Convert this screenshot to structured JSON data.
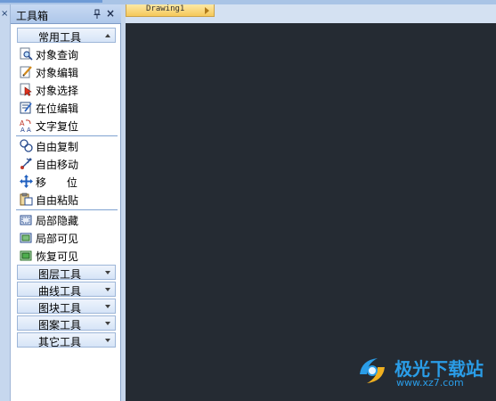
{
  "left_strip": {
    "close_glyph": "×"
  },
  "toolbox": {
    "title": "工具箱",
    "pin_icon": "pin-icon",
    "close_glyph": "×",
    "groups": [
      {
        "label": "常用工具",
        "expanded": true
      },
      {
        "label": "图层工具",
        "expanded": false
      },
      {
        "label": "曲线工具",
        "expanded": false
      },
      {
        "label": "图块工具",
        "expanded": false
      },
      {
        "label": "图案工具",
        "expanded": false
      },
      {
        "label": "其它工具",
        "expanded": false
      }
    ],
    "items": [
      {
        "label": "对象查询",
        "icon": "magnifier-doc-icon"
      },
      {
        "label": "对象编辑",
        "icon": "pencil-doc-icon"
      },
      {
        "label": "对象选择",
        "icon": "select-arrow-icon"
      },
      {
        "label": "在位编辑",
        "icon": "inplace-edit-icon"
      },
      {
        "label": "文字复位",
        "icon": "text-reset-icon"
      },
      {
        "label": "自由复制",
        "icon": "copy-circles-icon"
      },
      {
        "label": "自由移动",
        "icon": "free-move-icon"
      },
      {
        "label": "移      位",
        "icon": "move-cross-icon"
      },
      {
        "label": "自由粘贴",
        "icon": "paste-icon"
      },
      {
        "label": "局部隐藏",
        "icon": "partial-hide-icon"
      },
      {
        "label": "局部可见",
        "icon": "partial-show-icon"
      },
      {
        "label": "恢复可见",
        "icon": "restore-visible-icon"
      }
    ]
  },
  "document": {
    "tab_label": "Drawing1"
  },
  "colors": {
    "canvas": "#252b33",
    "panel_header": "#aec7ea",
    "tab_active": "#f5c85a",
    "watermark": "#2a9de8"
  },
  "watermark": {
    "brand": "极光下载站",
    "url": "www.xz7.com"
  }
}
